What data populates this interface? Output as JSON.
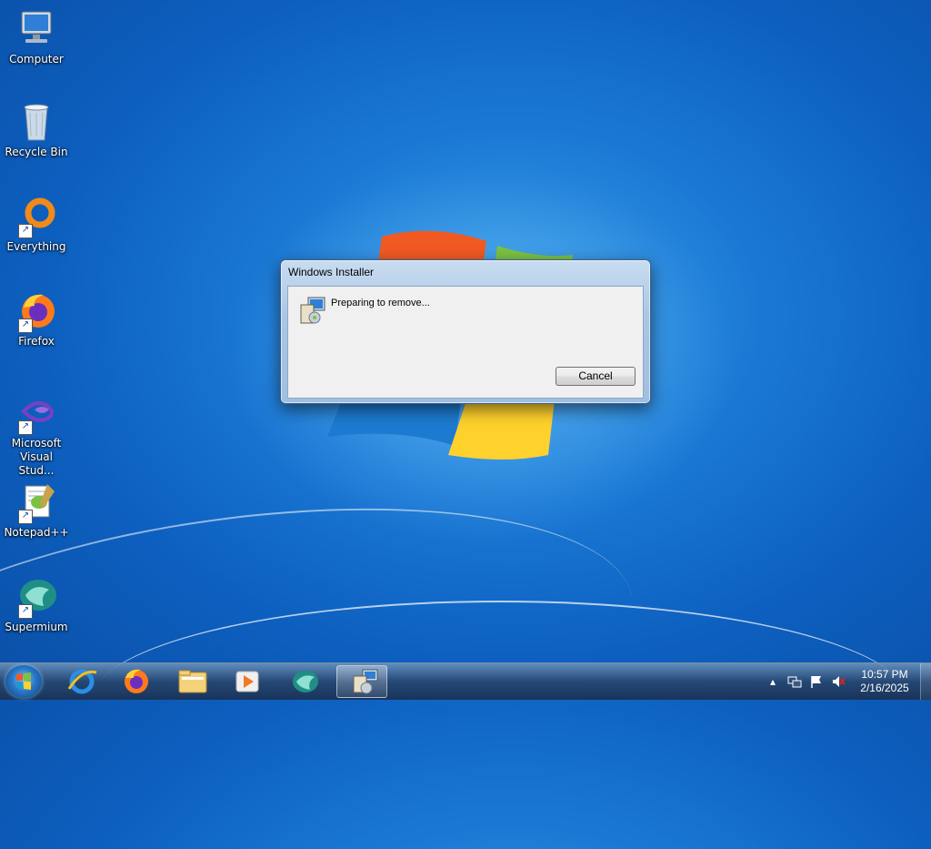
{
  "desktop": {
    "icons": [
      {
        "label": "Computer",
        "icon": "computer-icon"
      },
      {
        "label": "Recycle Bin",
        "icon": "recycle-bin-icon"
      },
      {
        "label": "Everything",
        "icon": "everything-icon"
      },
      {
        "label": "Firefox",
        "icon": "firefox-icon"
      },
      {
        "label": "Microsoft Visual Stud...",
        "icon": "visual-studio-icon"
      },
      {
        "label": "Notepad++",
        "icon": "notepad-plus-plus-icon"
      },
      {
        "label": "Supermium",
        "icon": "supermium-icon"
      }
    ]
  },
  "dialog": {
    "title": "Windows Installer",
    "message": "Preparing to remove...",
    "cancel_label": "Cancel",
    "icon": "installer-icon"
  },
  "taskbar": {
    "items": [
      {
        "icon": "internet-explorer-icon"
      },
      {
        "icon": "firefox-icon"
      },
      {
        "icon": "file-explorer-icon"
      },
      {
        "icon": "media-player-icon"
      },
      {
        "icon": "supermium-icon"
      },
      {
        "icon": "installer-icon",
        "active": true
      }
    ],
    "tray": {
      "icons": [
        "show-hidden-icons-arrow",
        "network-icon",
        "action-center-flag-icon",
        "volume-muted-icon"
      ]
    },
    "clock": {
      "time": "10:57 PM",
      "date": "2/16/2025"
    }
  },
  "colors": {
    "desktop_blue": "#1a78d4",
    "dialog_frame": "#a9c6e6",
    "taskbar": "#28466e"
  }
}
